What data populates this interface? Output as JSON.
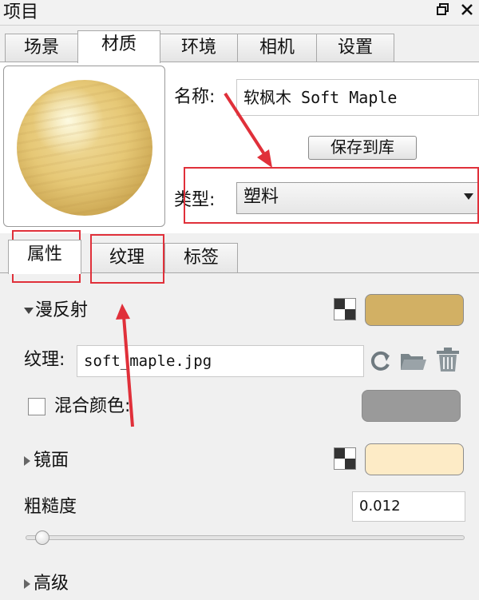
{
  "window": {
    "title": "项目",
    "restore_icon": "restore-window-icon",
    "close_icon": "close-icon"
  },
  "main_tabs": [
    {
      "label": "场景",
      "active": false
    },
    {
      "label": "材质",
      "active": true
    },
    {
      "label": "环境",
      "active": false
    },
    {
      "label": "相机",
      "active": false
    },
    {
      "label": "设置",
      "active": false
    }
  ],
  "material": {
    "name_label": "名称:",
    "name_value": "软枫木 Soft Maple",
    "save_button": "保存到库",
    "type_label": "类型:",
    "type_value": "塑料"
  },
  "sub_tabs": [
    {
      "label": "属性",
      "active": true
    },
    {
      "label": "纹理",
      "active": false
    },
    {
      "label": "标签",
      "active": false
    }
  ],
  "properties": {
    "diffuse_label": "漫反射",
    "diffuse_color": "#d2b064",
    "texture_label": "纹理:",
    "texture_value": "soft_maple.jpg",
    "blend_color_label": "混合颜色:",
    "blend_color": "#9a9a9a",
    "blend_checked": false,
    "specular_label": "镜面",
    "specular_color": "#fdebc6",
    "roughness_label": "粗糙度",
    "roughness_value": "0.012",
    "advanced_label": "高级"
  },
  "annotation_color": "#e0303a"
}
